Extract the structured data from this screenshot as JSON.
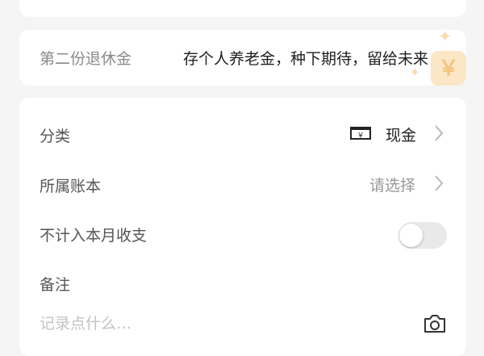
{
  "promo": {
    "label": "第二份退休金",
    "text": "存个人养老金，种下期待，留给未来",
    "coin_glyph": "￥"
  },
  "form": {
    "category": {
      "label": "分类",
      "value": "现金",
      "icon": "cash-icon"
    },
    "ledger": {
      "label": "所属账本",
      "value": "请选择"
    },
    "exclude": {
      "label": "不计入本月收支",
      "enabled": false
    },
    "note": {
      "label": "备注",
      "placeholder": "记录点什么…"
    }
  },
  "colors": {
    "background": "#f5f5f6",
    "card": "#ffffff",
    "toggle_off": "#e9e9ea",
    "accent_deco": "#f4c47f"
  }
}
